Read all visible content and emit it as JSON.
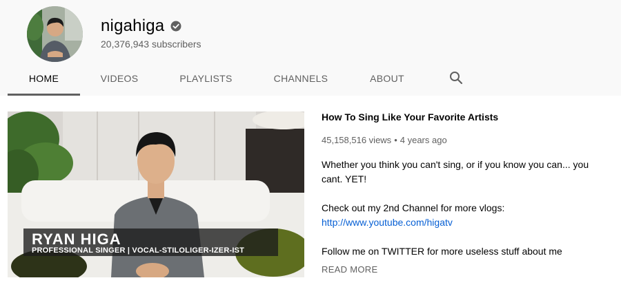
{
  "channel": {
    "name": "nigahiga",
    "subscribers": "20,376,943 subscribers",
    "verified": true
  },
  "tabs": [
    {
      "label": "HOME",
      "active": true
    },
    {
      "label": "VIDEOS",
      "active": false
    },
    {
      "label": "PLAYLISTS",
      "active": false
    },
    {
      "label": "CHANNELS",
      "active": false
    },
    {
      "label": "ABOUT",
      "active": false
    }
  ],
  "search_icon": "search-icon",
  "featured_video": {
    "title": "How To Sing Like Your Favorite Artists",
    "views": "45,158,516 views",
    "separator": "•",
    "age": "4 years ago",
    "thumbnail_name": "RYAN HIGA",
    "thumbnail_subtitle": "PROFESSIONAL SINGER | VOCAL-STILOLIGER-IZER-IST",
    "description_line1": "Whether you think you can't sing, or if you know you can... you cant. YET!",
    "description_line2": "Check out my 2nd Channel for more vlogs:",
    "description_link": "http://www.youtube.com/higatv",
    "description_line3": "Follow me on TWITTER for more useless stuff about me",
    "read_more": "READ MORE"
  },
  "colors": {
    "header_bg": "#f9f9f9",
    "link": "#065fd4",
    "secondary_text": "#606060"
  }
}
